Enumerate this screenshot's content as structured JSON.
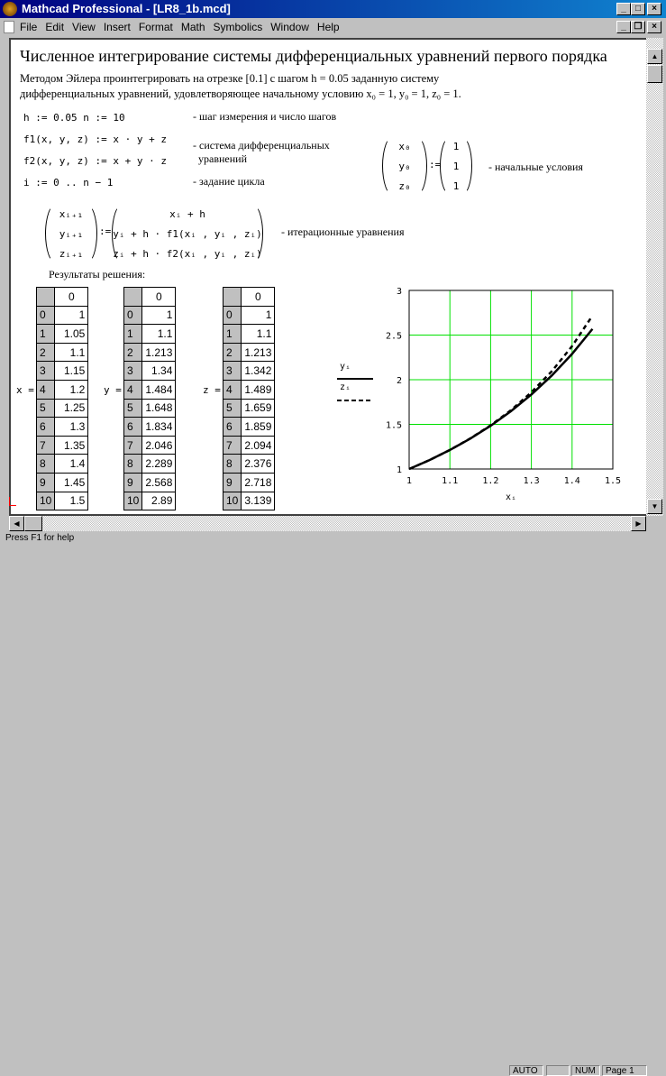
{
  "window": {
    "title": "Mathcad Professional - [LR8_1b.mcd]"
  },
  "menu": [
    "File",
    "Edit",
    "View",
    "Insert",
    "Format",
    "Math",
    "Symbolics",
    "Window",
    "Help"
  ],
  "doc": {
    "heading": "Численное интегрирование системы дифференциальных уравнений первого порядка",
    "intro1": "Методом Эйлера проинтегрировать на отрезке [0.1] с шагом  h = 0.05 заданную систему",
    "intro2": "дифференциальных уравнений, удовлетворяющее начальному условию x₀ = 1, y₀ = 1,  z₀ = 1.",
    "eq_h": "h := 0.05    n := 10",
    "eq_f1": "f1(x, y, z) := x · y + z",
    "eq_f2": "f2(x, y, z) := x + y · z",
    "eq_i": "i := 0 ..  n − 1",
    "c_step": "- шаг измерения и число шагов",
    "c_sys1": "- система дифференциальных",
    "c_sys2": "уравнений",
    "c_loop": "- задание цикла",
    "init_lhs": [
      "x₀",
      "y₀",
      "z₀"
    ],
    "init_rhs": [
      "1",
      "1",
      "1"
    ],
    "c_init": "- начальные условия",
    "iter_lhs": [
      "xᵢ₊₁",
      "yᵢ₊₁",
      "zᵢ₊₁"
    ],
    "iter_rhs": [
      "xᵢ + h",
      "yᵢ + h · f1(xᵢ , yᵢ , zᵢ)",
      "zᵢ + h · f2(xᵢ , yᵢ , zᵢ)"
    ],
    "assign": ":=",
    "c_iter": "- итерационные уравнения",
    "results_label": "Результаты решения:"
  },
  "tables": [
    {
      "label": "x =",
      "header": "0",
      "values": [
        "1",
        "1.05",
        "1.1",
        "1.15",
        "1.2",
        "1.25",
        "1.3",
        "1.35",
        "1.4",
        "1.45",
        "1.5"
      ]
    },
    {
      "label": "y =",
      "header": "0",
      "values": [
        "1",
        "1.1",
        "1.213",
        "1.34",
        "1.484",
        "1.648",
        "1.834",
        "2.046",
        "2.289",
        "2.568",
        "2.89"
      ]
    },
    {
      "label": "z =",
      "header": "0",
      "values": [
        "1",
        "1.1",
        "1.213",
        "1.342",
        "1.489",
        "1.659",
        "1.859",
        "2.094",
        "2.376",
        "2.718",
        "3.139"
      ]
    }
  ],
  "chart_data": {
    "type": "line",
    "x": [
      1,
      1.05,
      1.1,
      1.15,
      1.2,
      1.25,
      1.3,
      1.35,
      1.4,
      1.45
    ],
    "series": [
      {
        "name": "yᵢ",
        "style": "solid",
        "values": [
          1,
          1.1,
          1.213,
          1.34,
          1.484,
          1.648,
          1.834,
          2.046,
          2.289,
          2.568
        ]
      },
      {
        "name": "zᵢ",
        "style": "dashed",
        "values": [
          1,
          1.1,
          1.213,
          1.342,
          1.489,
          1.659,
          1.859,
          2.094,
          2.376,
          2.718
        ]
      }
    ],
    "xlabel": "xᵢ",
    "xlim": [
      1,
      1.5
    ],
    "ylim": [
      1,
      3
    ],
    "xticks": [
      "1",
      "1.1",
      "1.2",
      "1.3",
      "1.4",
      "1.5"
    ],
    "yticks": [
      "1",
      "1.5",
      "2",
      "2.5",
      "3"
    ],
    "grid": true,
    "grid_color": "#00e000",
    "legend_placement": "left"
  },
  "status": {
    "help": "Press F1 for help",
    "auto": "AUTO",
    "blank": "",
    "num": "NUM",
    "page": "Page 1"
  }
}
